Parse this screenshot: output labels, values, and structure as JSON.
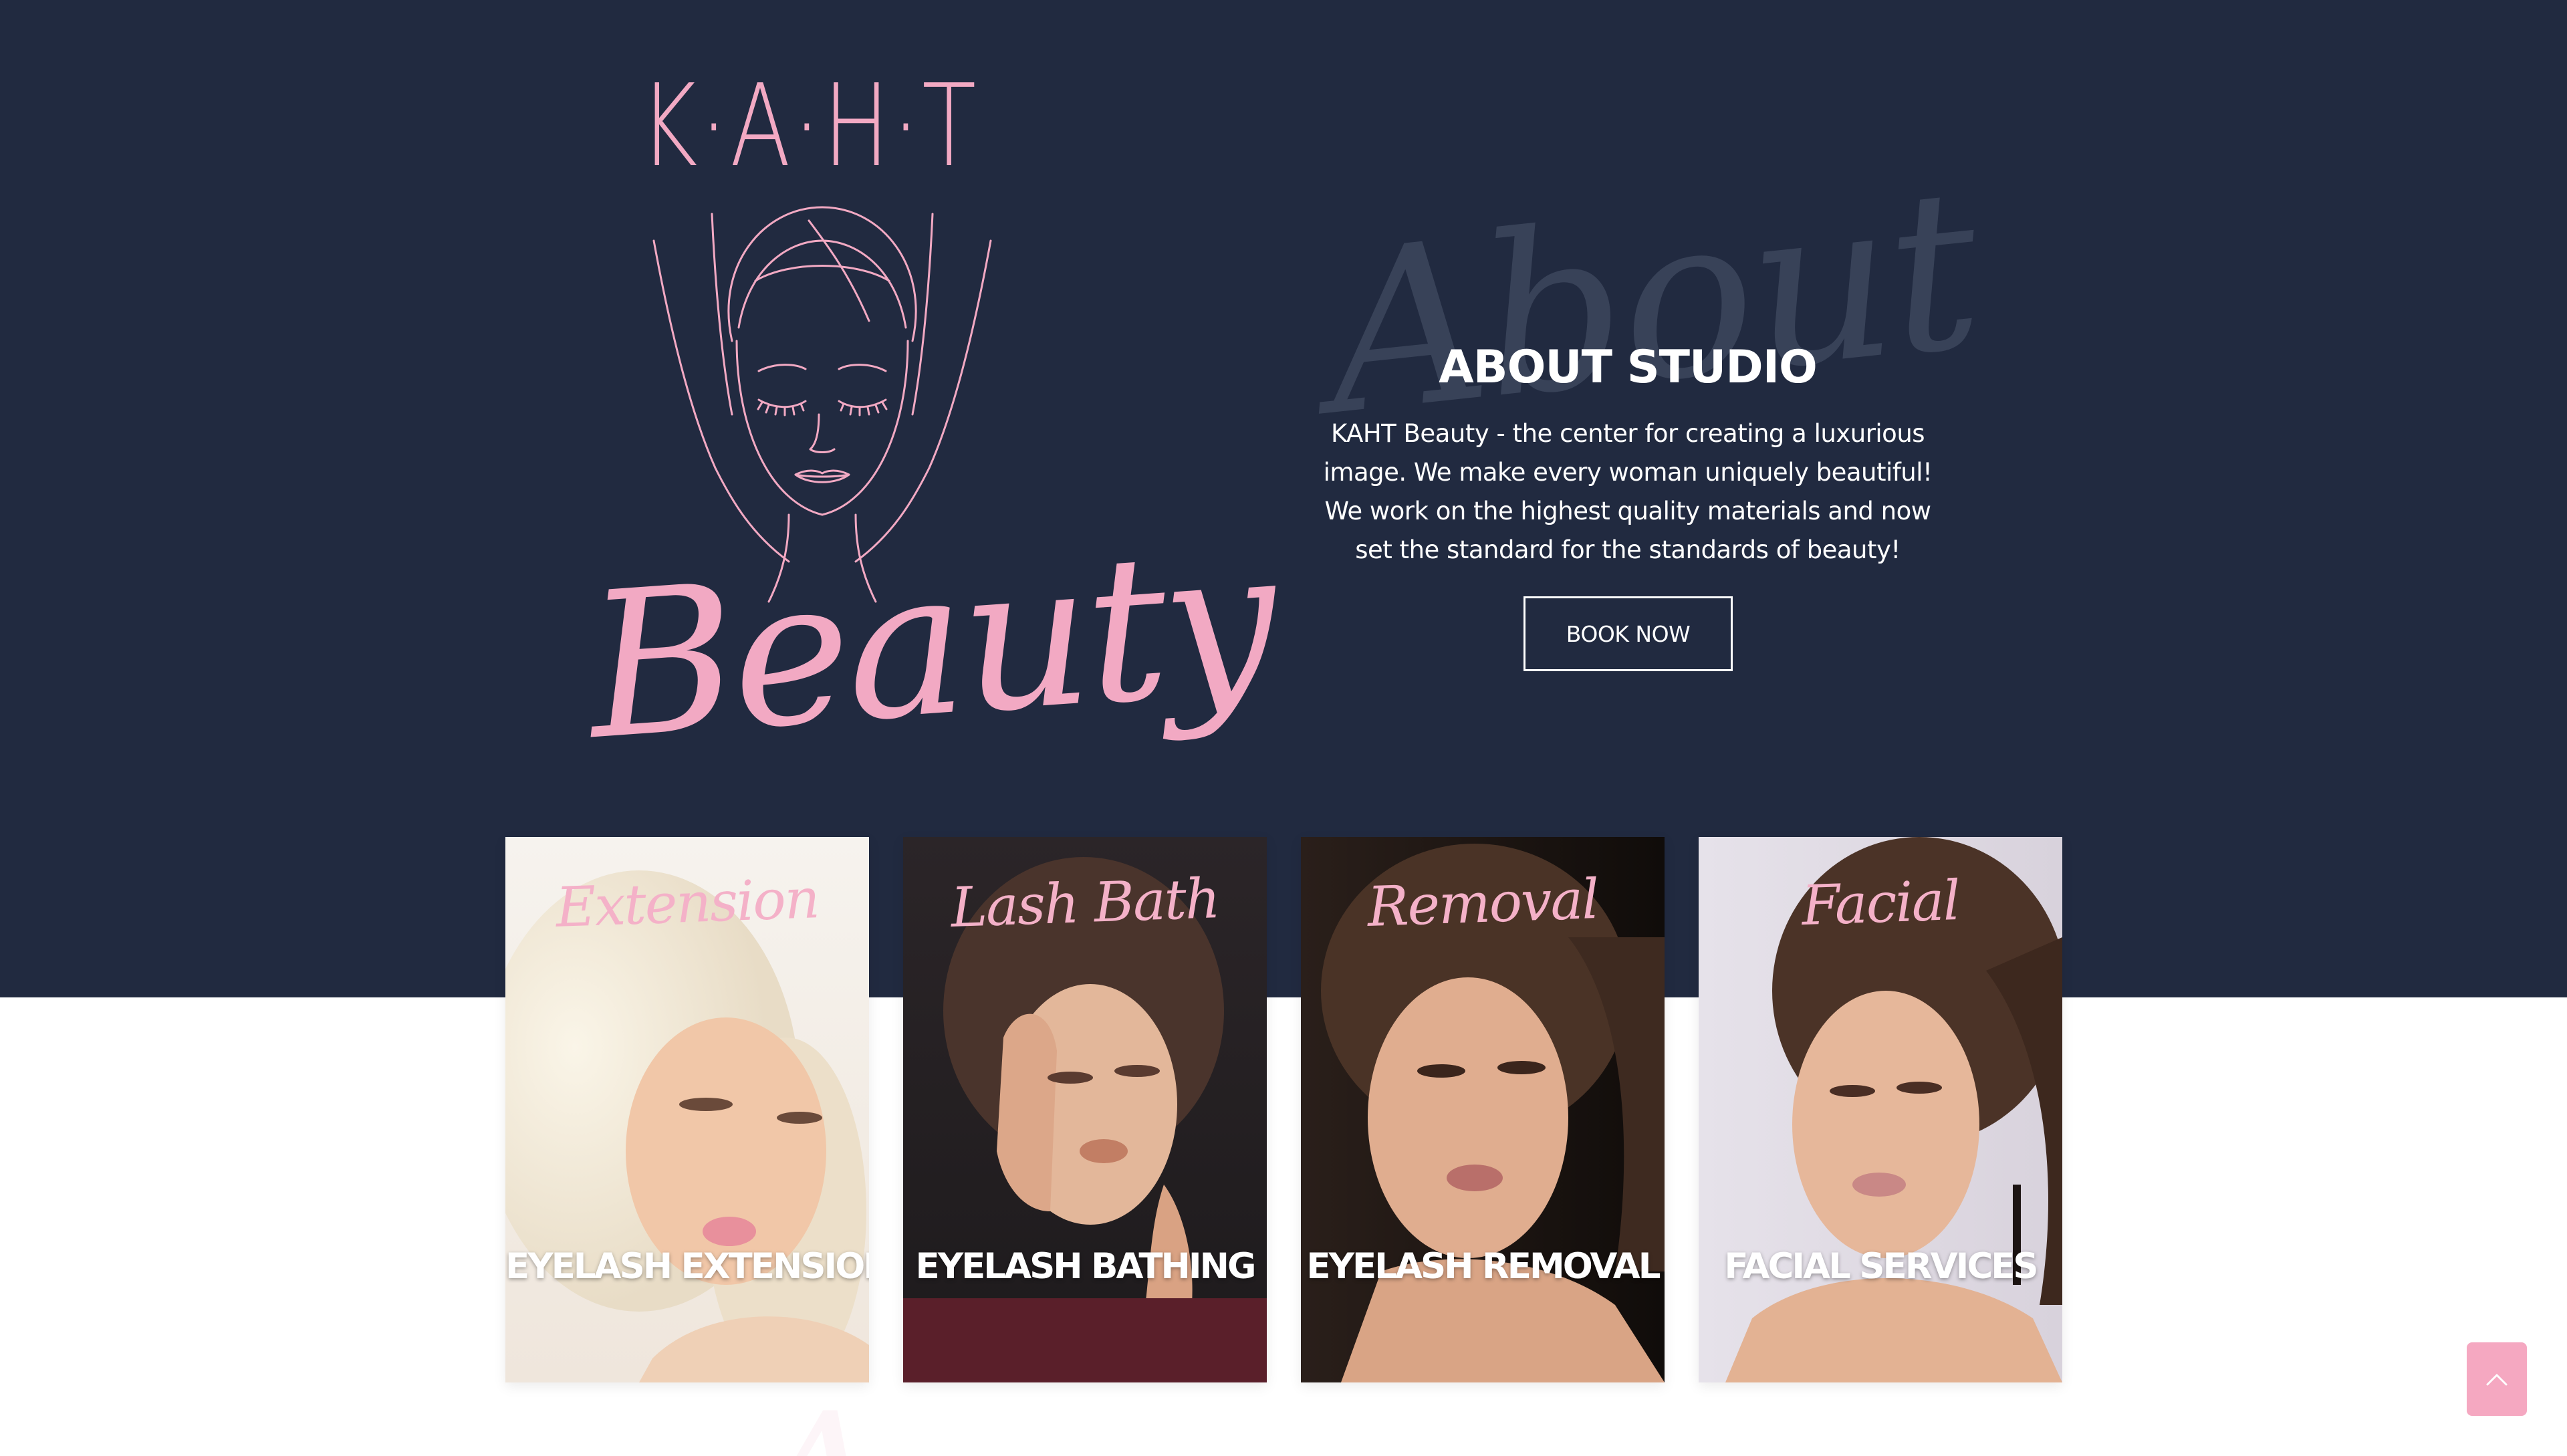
{
  "logo": {
    "wordmark": "K·A·H·T",
    "script": "Beauty"
  },
  "about": {
    "watermark": "About",
    "title": "ABOUT STUDIO",
    "text": "KAHT Beauty - the center for creating a luxurious image. We make every woman uniquely beautiful! We work on the highest quality materials and now set the standard for the standards of beauty!",
    "button_label": "BOOK NOW"
  },
  "services": [
    {
      "script": "Extension",
      "label": "EYELASH EXTENSION"
    },
    {
      "script": "Lash Bath",
      "label": "EYELASH BATHING"
    },
    {
      "script": "Removal",
      "label": "EYELASH REMOVAL"
    },
    {
      "script": "Facial",
      "label": "FACIAL SERVICES"
    }
  ],
  "colors": {
    "navy": "#212a40",
    "pink": "#f2a9c3",
    "white": "#ffffff"
  },
  "icons": {
    "scroll_top": "chevron-up-icon"
  }
}
